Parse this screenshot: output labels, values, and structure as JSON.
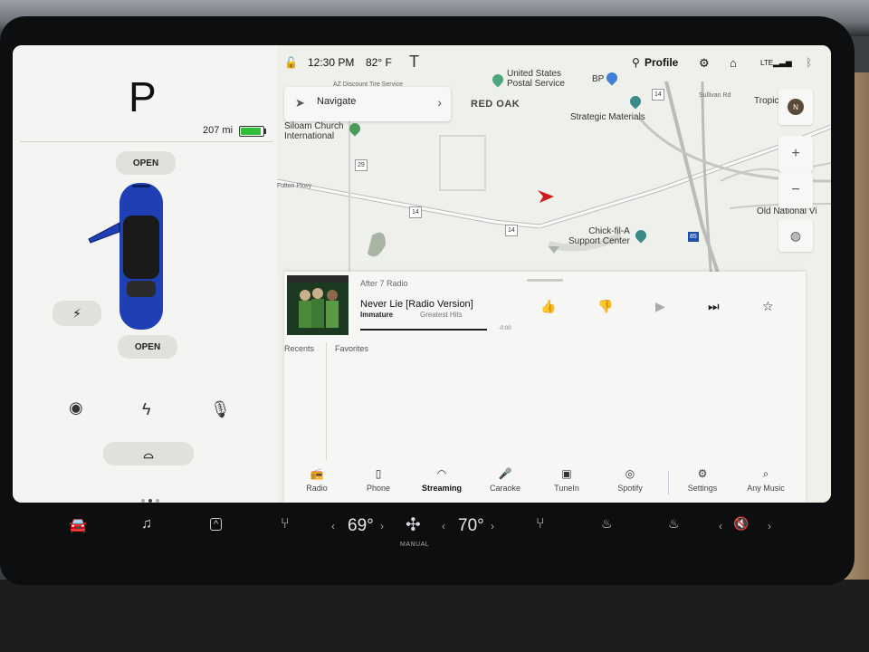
{
  "car_panel": {
    "gear": "P",
    "range": "207 mi",
    "battery_level": 0.9,
    "frunk_label": "OPEN",
    "trunk_label": "OPEN",
    "charge_port_icon": "lightning-icon",
    "controls": [
      "headlights-icon",
      "power-icon",
      "microphone-icon"
    ],
    "wiper_icon": "windshield-wiper-icon"
  },
  "status_bar": {
    "time": "12:30 PM",
    "temperature": "82° F",
    "profile_label": "Profile",
    "network": "LTE"
  },
  "navigate": {
    "label": "Navigate"
  },
  "map": {
    "labels": {
      "usps": "United States\nPostal Service",
      "tire": "AZ Discount Tire Service",
      "bp": "BP",
      "red_oak": "RED OAK",
      "strategic": "Strategic Materials",
      "siloam": "Siloam Church\nInternational",
      "fulton": "Fulton Pkwy",
      "chick": "Chick-fil-A\nSupport Center",
      "old_national": "Old National Vi",
      "tropic": "Tropic",
      "sullivan": "Sullivan Rd",
      "shield_29": "29",
      "shield_14a": "14",
      "shield_14b": "14",
      "shield_14c": "14",
      "shield_85": "85"
    },
    "compass": "N",
    "zoom_in": "+",
    "zoom_out": "−"
  },
  "media": {
    "station": "After 7 Radio",
    "song_title": "Never Lie [Radio Version]",
    "artist": "Immature",
    "album": "Greatest Hits",
    "time": "-0:00",
    "tabs": [
      "Recents",
      "Favorites"
    ],
    "sources": [
      {
        "label": "Radio",
        "icon": "radio-icon"
      },
      {
        "label": "Phone",
        "icon": "phone-icon"
      },
      {
        "label": "Streaming",
        "icon": "streaming-icon",
        "active": true
      },
      {
        "label": "Caraoke",
        "icon": "microphone-icon"
      },
      {
        "label": "TuneIn",
        "icon": "tunein-icon"
      },
      {
        "label": "Spotify",
        "icon": "spotify-icon"
      },
      {
        "label": "Settings",
        "icon": "gear-icon"
      },
      {
        "label": "Any Music",
        "icon": "search-icon"
      }
    ]
  },
  "climate": {
    "driver_temp": "69°",
    "passenger_temp": "70°",
    "fan_mode": "MANUAL"
  },
  "colors": {
    "screen_bg": "#f1f3ef",
    "car_body": "#1f3fb5",
    "nav_arrow": "#d11a1a",
    "battery": "#2fbf3a"
  }
}
